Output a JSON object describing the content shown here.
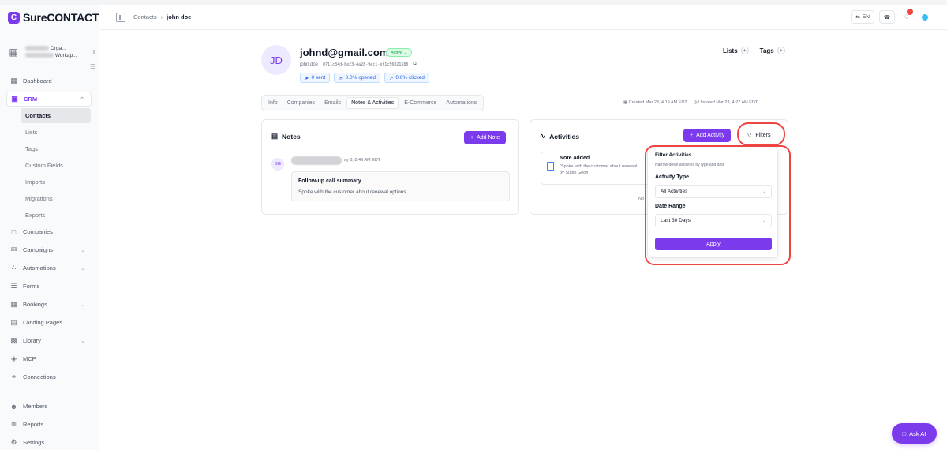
{
  "brand": {
    "mark": "C",
    "name": "SureCONTACT",
    "brand_color": "#7c3aed"
  },
  "org": {
    "line1": "Orga...",
    "line2": "Workap..."
  },
  "sidebar": {
    "items": [
      {
        "label": "Dashboard",
        "icon": "dashboard-icon"
      },
      {
        "label": "CRM",
        "icon": "crm-icon"
      },
      {
        "label": "Companies",
        "icon": "companies-icon"
      },
      {
        "label": "Campaigns",
        "icon": "campaigns-icon"
      },
      {
        "label": "Automations",
        "icon": "automations-icon"
      },
      {
        "label": "Forms",
        "icon": "forms-icon"
      },
      {
        "label": "Bookings",
        "icon": "bookings-icon"
      },
      {
        "label": "Landing Pages",
        "icon": "landing-pages-icon"
      },
      {
        "label": "Library",
        "icon": "library-icon"
      },
      {
        "label": "MCP",
        "icon": "mcp-icon"
      },
      {
        "label": "Connections",
        "icon": "connections-icon"
      },
      {
        "label": "Members",
        "icon": "members-icon"
      },
      {
        "label": "Reports",
        "icon": "reports-icon"
      },
      {
        "label": "Settings",
        "icon": "settings-icon"
      }
    ],
    "crm_sub": [
      "Contacts",
      "Lists",
      "Tags",
      "Custom Fields",
      "Imports",
      "Migrations",
      "Exports"
    ]
  },
  "topbar": {
    "breadcrumb": [
      "Contacts",
      "john doe"
    ],
    "lang": "EN"
  },
  "contact": {
    "initials": "JD",
    "email": "johnd@gmail.com",
    "status": "Active",
    "name": "john doe",
    "id": "0711c34d-0e23-4a28-9ec1-ef1c56021580",
    "stats": {
      "sent": "0 sent",
      "opened": "0.0% opened",
      "clicked": "0.0% clicked"
    },
    "lists_label": "Lists",
    "tags_label": "Tags"
  },
  "tabs": [
    "Info",
    "Companies",
    "Emails",
    "Notes & Activities",
    "E-Commerce",
    "Automations"
  ],
  "meta": {
    "created": "Created Mar 23, 4:19 AM EDT",
    "updated": "Updated Mar 23, 4:27 AM EDT"
  },
  "notes": {
    "title": "Notes",
    "add_label": "Add Note",
    "item": {
      "author_initials": "SG",
      "date": "ay 8, 8:49 AM EDT",
      "title": "Follow-up call summary",
      "body": "Spoke with the customer about renewal options."
    }
  },
  "activities": {
    "title": "Activities",
    "add_label": "Add Activity",
    "filters_label": "Filters",
    "item": {
      "title": "Note added",
      "body_line1": "\"Spoke with the customer about renewal",
      "body_line2": "by Subin Georj"
    },
    "more_text": "No"
  },
  "filter_popup": {
    "title": "Filter Activities",
    "subtitle": "Narrow down activities by type and date",
    "activity_type_label": "Activity Type",
    "activity_type_value": "All Activities",
    "date_range_label": "Date Range",
    "date_range_value": "Last 30 Days",
    "apply_label": "Apply"
  },
  "ask_ai": {
    "label": "Ask AI"
  },
  "colors": {
    "accent": "#7c3aed",
    "highlight": "#ef4444",
    "active_green": "#16a34a",
    "stat_blue": "#2563eb"
  }
}
